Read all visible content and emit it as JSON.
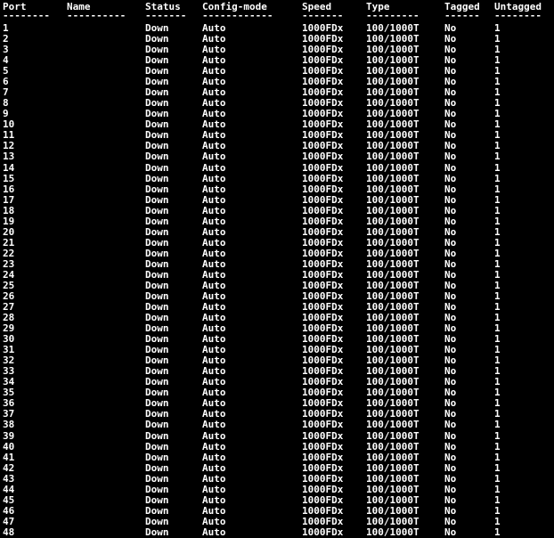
{
  "headers": {
    "port": "Port",
    "name": "Name",
    "status": "Status",
    "config": "Config-mode",
    "speed": "Speed",
    "type": "Type",
    "tagged": "Tagged",
    "untagged": "Untagged"
  },
  "separators": {
    "port": "--------",
    "name": "----------",
    "status": "-------",
    "config": "------------",
    "speed": "-------",
    "type": "---------",
    "tagged": "------",
    "untagged": "--------"
  },
  "rows": [
    {
      "port": "1",
      "status": "Down",
      "config": "Auto",
      "speed": "1000FDx",
      "type": "100/1000T",
      "tagged": "No",
      "untagged": "1"
    },
    {
      "port": "2",
      "status": "Down",
      "config": "Auto",
      "speed": "1000FDx",
      "type": "100/1000T",
      "tagged": "No",
      "untagged": "1"
    },
    {
      "port": "3",
      "status": "Down",
      "config": "Auto",
      "speed": "1000FDx",
      "type": "100/1000T",
      "tagged": "No",
      "untagged": "1"
    },
    {
      "port": "4",
      "status": "Down",
      "config": "Auto",
      "speed": "1000FDx",
      "type": "100/1000T",
      "tagged": "No",
      "untagged": "1"
    },
    {
      "port": "5",
      "status": "Down",
      "config": "Auto",
      "speed": "1000FDx",
      "type": "100/1000T",
      "tagged": "No",
      "untagged": "1"
    },
    {
      "port": "6",
      "status": "Down",
      "config": "Auto",
      "speed": "1000FDx",
      "type": "100/1000T",
      "tagged": "No",
      "untagged": "1"
    },
    {
      "port": "7",
      "status": "Down",
      "config": "Auto",
      "speed": "1000FDx",
      "type": "100/1000T",
      "tagged": "No",
      "untagged": "1"
    },
    {
      "port": "8",
      "status": "Down",
      "config": "Auto",
      "speed": "1000FDx",
      "type": "100/1000T",
      "tagged": "No",
      "untagged": "1"
    },
    {
      "port": "9",
      "status": "Down",
      "config": "Auto",
      "speed": "1000FDx",
      "type": "100/1000T",
      "tagged": "No",
      "untagged": "1"
    },
    {
      "port": "10",
      "status": "Down",
      "config": "Auto",
      "speed": "1000FDx",
      "type": "100/1000T",
      "tagged": "No",
      "untagged": "1"
    },
    {
      "port": "11",
      "status": "Down",
      "config": "Auto",
      "speed": "1000FDx",
      "type": "100/1000T",
      "tagged": "No",
      "untagged": "1"
    },
    {
      "port": "12",
      "status": "Down",
      "config": "Auto",
      "speed": "1000FDx",
      "type": "100/1000T",
      "tagged": "No",
      "untagged": "1"
    },
    {
      "port": "13",
      "status": "Down",
      "config": "Auto",
      "speed": "1000FDx",
      "type": "100/1000T",
      "tagged": "No",
      "untagged": "1"
    },
    {
      "port": "14",
      "status": "Down",
      "config": "Auto",
      "speed": "1000FDx",
      "type": "100/1000T",
      "tagged": "No",
      "untagged": "1"
    },
    {
      "port": "15",
      "status": "Down",
      "config": "Auto",
      "speed": "1000FDx",
      "type": "100/1000T",
      "tagged": "No",
      "untagged": "1"
    },
    {
      "port": "16",
      "status": "Down",
      "config": "Auto",
      "speed": "1000FDx",
      "type": "100/1000T",
      "tagged": "No",
      "untagged": "1"
    },
    {
      "port": "17",
      "status": "Down",
      "config": "Auto",
      "speed": "1000FDx",
      "type": "100/1000T",
      "tagged": "No",
      "untagged": "1"
    },
    {
      "port": "18",
      "status": "Down",
      "config": "Auto",
      "speed": "1000FDx",
      "type": "100/1000T",
      "tagged": "No",
      "untagged": "1"
    },
    {
      "port": "19",
      "status": "Down",
      "config": "Auto",
      "speed": "1000FDx",
      "type": "100/1000T",
      "tagged": "No",
      "untagged": "1"
    },
    {
      "port": "20",
      "status": "Down",
      "config": "Auto",
      "speed": "1000FDx",
      "type": "100/1000T",
      "tagged": "No",
      "untagged": "1"
    },
    {
      "port": "21",
      "status": "Down",
      "config": "Auto",
      "speed": "1000FDx",
      "type": "100/1000T",
      "tagged": "No",
      "untagged": "1"
    },
    {
      "port": "22",
      "status": "Down",
      "config": "Auto",
      "speed": "1000FDx",
      "type": "100/1000T",
      "tagged": "No",
      "untagged": "1"
    },
    {
      "port": "23",
      "status": "Down",
      "config": "Auto",
      "speed": "1000FDx",
      "type": "100/1000T",
      "tagged": "No",
      "untagged": "1"
    },
    {
      "port": "24",
      "status": "Down",
      "config": "Auto",
      "speed": "1000FDx",
      "type": "100/1000T",
      "tagged": "No",
      "untagged": "1"
    },
    {
      "port": "25",
      "status": "Down",
      "config": "Auto",
      "speed": "1000FDx",
      "type": "100/1000T",
      "tagged": "No",
      "untagged": "1"
    },
    {
      "port": "26",
      "status": "Down",
      "config": "Auto",
      "speed": "1000FDx",
      "type": "100/1000T",
      "tagged": "No",
      "untagged": "1"
    },
    {
      "port": "27",
      "status": "Down",
      "config": "Auto",
      "speed": "1000FDx",
      "type": "100/1000T",
      "tagged": "No",
      "untagged": "1"
    },
    {
      "port": "28",
      "status": "Down",
      "config": "Auto",
      "speed": "1000FDx",
      "type": "100/1000T",
      "tagged": "No",
      "untagged": "1"
    },
    {
      "port": "29",
      "status": "Down",
      "config": "Auto",
      "speed": "1000FDx",
      "type": "100/1000T",
      "tagged": "No",
      "untagged": "1"
    },
    {
      "port": "30",
      "status": "Down",
      "config": "Auto",
      "speed": "1000FDx",
      "type": "100/1000T",
      "tagged": "No",
      "untagged": "1"
    },
    {
      "port": "31",
      "status": "Down",
      "config": "Auto",
      "speed": "1000FDx",
      "type": "100/1000T",
      "tagged": "No",
      "untagged": "1"
    },
    {
      "port": "32",
      "status": "Down",
      "config": "Auto",
      "speed": "1000FDx",
      "type": "100/1000T",
      "tagged": "No",
      "untagged": "1"
    },
    {
      "port": "33",
      "status": "Down",
      "config": "Auto",
      "speed": "1000FDx",
      "type": "100/1000T",
      "tagged": "No",
      "untagged": "1"
    },
    {
      "port": "34",
      "status": "Down",
      "config": "Auto",
      "speed": "1000FDx",
      "type": "100/1000T",
      "tagged": "No",
      "untagged": "1"
    },
    {
      "port": "35",
      "status": "Down",
      "config": "Auto",
      "speed": "1000FDx",
      "type": "100/1000T",
      "tagged": "No",
      "untagged": "1"
    },
    {
      "port": "36",
      "status": "Down",
      "config": "Auto",
      "speed": "1000FDx",
      "type": "100/1000T",
      "tagged": "No",
      "untagged": "1"
    },
    {
      "port": "37",
      "status": "Down",
      "config": "Auto",
      "speed": "1000FDx",
      "type": "100/1000T",
      "tagged": "No",
      "untagged": "1"
    },
    {
      "port": "38",
      "status": "Down",
      "config": "Auto",
      "speed": "1000FDx",
      "type": "100/1000T",
      "tagged": "No",
      "untagged": "1"
    },
    {
      "port": "39",
      "status": "Down",
      "config": "Auto",
      "speed": "1000FDx",
      "type": "100/1000T",
      "tagged": "No",
      "untagged": "1"
    },
    {
      "port": "40",
      "status": "Down",
      "config": "Auto",
      "speed": "1000FDx",
      "type": "100/1000T",
      "tagged": "No",
      "untagged": "1"
    },
    {
      "port": "41",
      "status": "Down",
      "config": "Auto",
      "speed": "1000FDx",
      "type": "100/1000T",
      "tagged": "No",
      "untagged": "1"
    },
    {
      "port": "42",
      "status": "Down",
      "config": "Auto",
      "speed": "1000FDx",
      "type": "100/1000T",
      "tagged": "No",
      "untagged": "1"
    },
    {
      "port": "43",
      "status": "Down",
      "config": "Auto",
      "speed": "1000FDx",
      "type": "100/1000T",
      "tagged": "No",
      "untagged": "1"
    },
    {
      "port": "44",
      "status": "Down",
      "config": "Auto",
      "speed": "1000FDx",
      "type": "100/1000T",
      "tagged": "No",
      "untagged": "1"
    },
    {
      "port": "45",
      "status": "Down",
      "config": "Auto",
      "speed": "1000FDx",
      "type": "100/1000T",
      "tagged": "No",
      "untagged": "1"
    },
    {
      "port": "46",
      "status": "Down",
      "config": "Auto",
      "speed": "1000FDx",
      "type": "100/1000T",
      "tagged": "No",
      "untagged": "1"
    },
    {
      "port": "47",
      "status": "Down",
      "config": "Auto",
      "speed": "1000FDx",
      "type": "100/1000T",
      "tagged": "No",
      "untagged": "1"
    },
    {
      "port": "48",
      "status": "Down",
      "config": "Auto",
      "speed": "1000FDx",
      "type": "100/1000T",
      "tagged": "No",
      "untagged": "1"
    }
  ]
}
